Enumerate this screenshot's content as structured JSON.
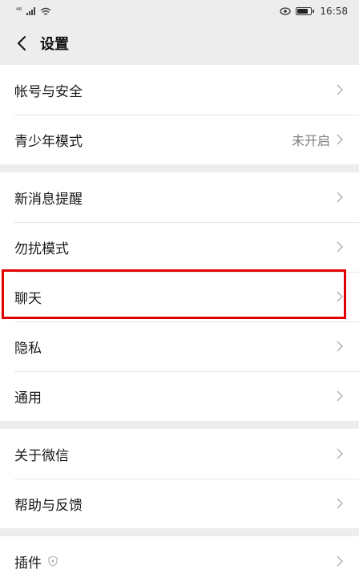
{
  "status_bar": {
    "carrier": "⁴⁶",
    "time": "16:58"
  },
  "nav": {
    "title": "设置"
  },
  "groups": [
    {
      "items": [
        {
          "label": "帐号与安全",
          "value": ""
        },
        {
          "label": "青少年模式",
          "value": "未开启"
        }
      ]
    },
    {
      "items": [
        {
          "label": "新消息提醒",
          "value": ""
        },
        {
          "label": "勿扰模式",
          "value": ""
        },
        {
          "label": "聊天",
          "value": ""
        },
        {
          "label": "隐私",
          "value": ""
        },
        {
          "label": "通用",
          "value": ""
        }
      ]
    },
    {
      "items": [
        {
          "label": "关于微信",
          "value": ""
        },
        {
          "label": "帮助与反馈",
          "value": ""
        }
      ]
    },
    {
      "items": [
        {
          "label": "插件",
          "value": ""
        }
      ]
    }
  ],
  "colors": {
    "background": "#ededed",
    "highlight": "#e00000"
  }
}
